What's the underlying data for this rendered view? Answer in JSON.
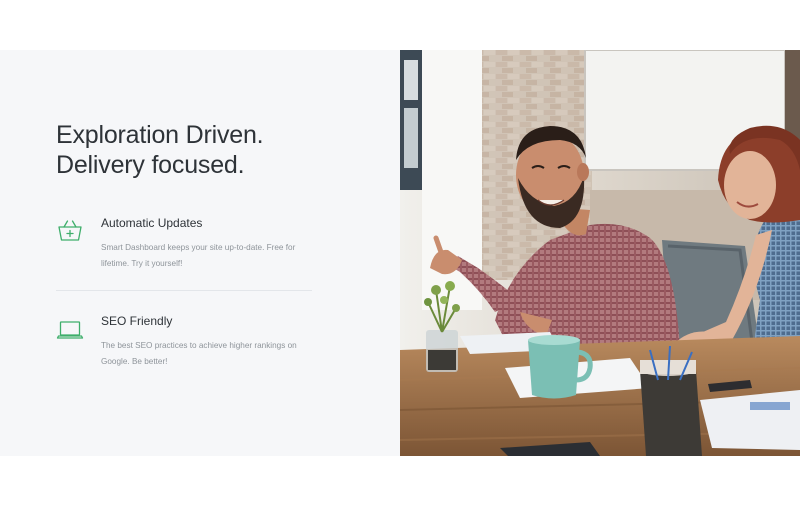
{
  "hero": {
    "headline_line1": "Exploration Driven.",
    "headline_line2": "Delivery focused."
  },
  "features": [
    {
      "icon": "basket-icon",
      "title": "Automatic Updates",
      "description": "Smart Dashboard keeps your site up-to-date. Free for lifetime. Try it yourself!"
    },
    {
      "icon": "laptop-icon",
      "title": "SEO Friendly",
      "description": "The best SEO practices to achieve higher rankings on Google. Be better!"
    }
  ],
  "colors": {
    "accent": "#3fae6b",
    "panel_bg": "#f6f7f9",
    "heading": "#2e3338",
    "muted_text": "#8e949a"
  }
}
